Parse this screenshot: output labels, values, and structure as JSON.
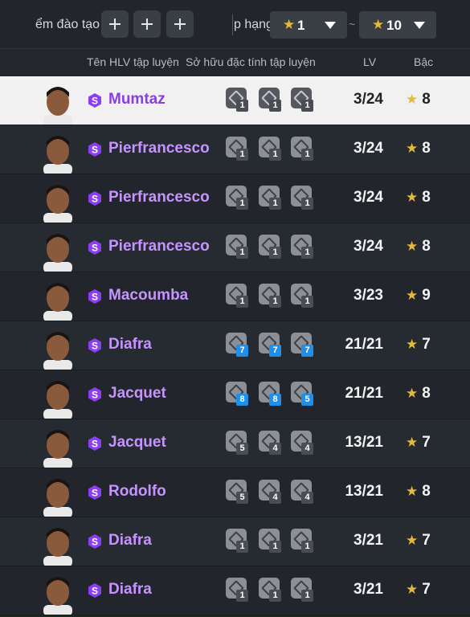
{
  "filter": {
    "train_label": "ểm đào tạo",
    "rank_label": "p hạng",
    "rank_min": "1",
    "rank_max": "10",
    "tilde": "~"
  },
  "columns": {
    "name": "Tên HLV tập luyện",
    "traits": "Sở hữu đặc tính tập luyện",
    "lv": "LV",
    "rank": "Bậc"
  },
  "colors": {
    "accent_purple": "#c693ff",
    "star": "#e5b93a",
    "badge_blue": "#1f8fe8"
  },
  "rows": [
    {
      "name": "Mumtaz",
      "lv": "3/24",
      "rank": "8",
      "traits": [
        {
          "n": "1",
          "blue": false
        },
        {
          "n": "1",
          "blue": false
        },
        {
          "n": "1",
          "blue": false
        }
      ],
      "selected": true
    },
    {
      "name": "Pierfrancesco",
      "lv": "3/24",
      "rank": "8",
      "traits": [
        {
          "n": "1",
          "blue": false
        },
        {
          "n": "1",
          "blue": false
        },
        {
          "n": "1",
          "blue": false
        }
      ]
    },
    {
      "name": "Pierfrancesco",
      "lv": "3/24",
      "rank": "8",
      "traits": [
        {
          "n": "1",
          "blue": false
        },
        {
          "n": "1",
          "blue": false
        },
        {
          "n": "1",
          "blue": false
        }
      ]
    },
    {
      "name": "Pierfrancesco",
      "lv": "3/24",
      "rank": "8",
      "traits": [
        {
          "n": "1",
          "blue": false
        },
        {
          "n": "1",
          "blue": false
        },
        {
          "n": "1",
          "blue": false
        }
      ]
    },
    {
      "name": "Macoumba",
      "lv": "3/23",
      "rank": "9",
      "traits": [
        {
          "n": "1",
          "blue": false
        },
        {
          "n": "1",
          "blue": false
        },
        {
          "n": "1",
          "blue": false
        }
      ]
    },
    {
      "name": "Diafra",
      "lv": "21/21",
      "rank": "7",
      "traits": [
        {
          "n": "7",
          "blue": true
        },
        {
          "n": "7",
          "blue": true
        },
        {
          "n": "7",
          "blue": true
        }
      ]
    },
    {
      "name": "Jacquet",
      "lv": "21/21",
      "rank": "8",
      "traits": [
        {
          "n": "8",
          "blue": true
        },
        {
          "n": "8",
          "blue": true
        },
        {
          "n": "5",
          "blue": true
        }
      ]
    },
    {
      "name": "Jacquet",
      "lv": "13/21",
      "rank": "7",
      "traits": [
        {
          "n": "5",
          "blue": false
        },
        {
          "n": "4",
          "blue": false
        },
        {
          "n": "4",
          "blue": false
        }
      ]
    },
    {
      "name": "Rodolfo",
      "lv": "13/21",
      "rank": "8",
      "traits": [
        {
          "n": "5",
          "blue": false
        },
        {
          "n": "4",
          "blue": false
        },
        {
          "n": "4",
          "blue": false
        }
      ]
    },
    {
      "name": "Diafra",
      "lv": "3/21",
      "rank": "7",
      "traits": [
        {
          "n": "1",
          "blue": false
        },
        {
          "n": "1",
          "blue": false
        },
        {
          "n": "1",
          "blue": false
        }
      ]
    },
    {
      "name": "Diafra",
      "lv": "3/21",
      "rank": "7",
      "traits": [
        {
          "n": "1",
          "blue": false
        },
        {
          "n": "1",
          "blue": false
        },
        {
          "n": "1",
          "blue": false
        }
      ]
    }
  ]
}
